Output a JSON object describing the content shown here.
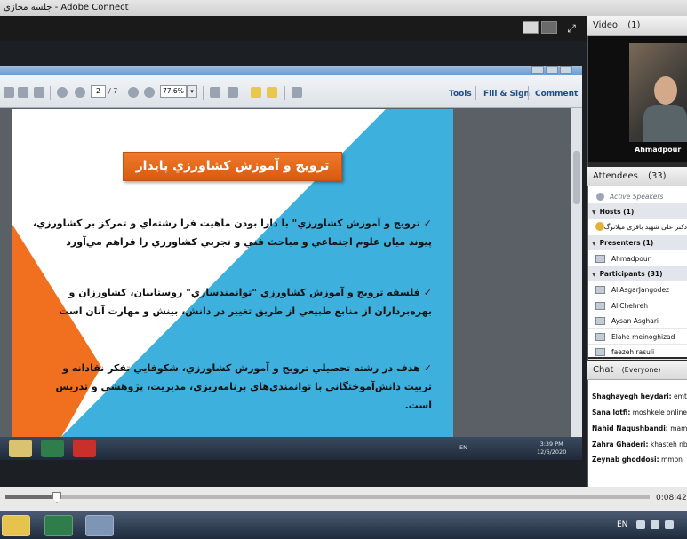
{
  "window": {
    "title": "جلسه مجازی - Adobe Connect"
  },
  "pdf_toolbar": {
    "page_current": "2",
    "page_total": "/ 7",
    "zoom": "77.6%",
    "tools_label": "Tools",
    "fill_sign_label": "Fill & Sign",
    "comment_label": "Comment"
  },
  "slide": {
    "title": "ترويج و آموزش كشاورزي پايدار",
    "bullets": [
      "ترويج و آموزش كشاورزي\" با دارا بودن ماهيت فرا رشته‌اي و تمركز بر كشاورزي، پيوند ميان علوم اجتماعي و مباحث فني و تجربي كشاورزي را فراهم مي‌آورد",
      "فلسفه ترويج و آموزش كشاورزي \"توانمندسازي\" روستاييان، كشاورزان و بهره‌برداران از منابع طبيعي از طريق تغيير در دانش، بينش و مهارت آنان است",
      "هدف در رشته تحصيلي ترويج و آموزش كشاورزي، شكوفايي تفكر نقادانه و تربيت دانش‌آموختگاني با توانمندي‌هاي برنامه‌ريزي، مديريت، پژوهشي و تدريس است."
    ]
  },
  "inner_taskbar": {
    "lang": "EN",
    "time": "3:39 PM",
    "date": "12/6/2020"
  },
  "playback": {
    "elapsed": "0:08:42",
    "progress": 0.08
  },
  "taskbar": {
    "lang": "EN"
  },
  "video_pod": {
    "title": "Video",
    "count": "(1)",
    "speaker_name": "Ahmadpour"
  },
  "attendees_pod": {
    "title": "Attendees",
    "count": "(33)",
    "active_speakers": "Active Speakers",
    "hosts_label": "Hosts (1)",
    "host_name": "دکتر علی شهید باقری میلاتوگ",
    "presenters_label": "Presenters (1)",
    "presenter_name": "Ahmadpour",
    "participants_label": "Participants (31)",
    "participants": [
      "AliAsgarJangodez",
      "AliChehreh",
      "Aysan Asghari",
      "Elahe meinoghizad",
      "faezeh rasuli"
    ]
  },
  "chat_pod": {
    "title": "Chat",
    "audience": "(Everyone)",
    "messages": [
      {
        "sender": "Shaghayegh heydari:",
        "text": "emt"
      },
      {
        "sender": "Sana lotfi:",
        "text": "moshkele online"
      },
      {
        "sender": "Nahid Naqushbandi:",
        "text": "mam"
      },
      {
        "sender": "Zahra Ghaderi:",
        "text": "khasteh nb"
      },
      {
        "sender": "Zeynab ghoddosi:",
        "text": "mmon"
      }
    ]
  },
  "colors": {
    "slide_orange": "#f07020",
    "slide_blue": "#3eb0dd",
    "slide_title_orange": "#e8671d"
  }
}
